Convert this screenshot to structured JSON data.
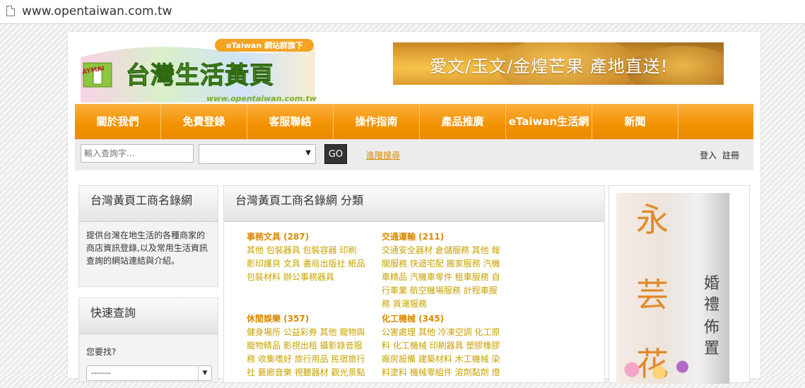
{
  "browser": {
    "url": "www.opentaiwan.com.tw"
  },
  "logo": {
    "badge": "eTaiwan 網站群旗下",
    "title": "台灣生活黃頁",
    "domain": "www.opentaiwan.com.tw",
    "mascot": "AYMAI"
  },
  "banner": {
    "text": "愛文/玉文/金煌芒果 產地直送!"
  },
  "nav": [
    {
      "label": "關於我們"
    },
    {
      "label": "免費登錄"
    },
    {
      "label": "客服聯絡"
    },
    {
      "label": "操作指南"
    },
    {
      "label": "產品推廣"
    },
    {
      "label": "eTaiwan生活網"
    },
    {
      "label": "新聞"
    },
    {
      "label": ""
    }
  ],
  "search": {
    "placeholder": "輸入查詢字...",
    "select_value": "",
    "go_label": "GO",
    "advanced_label": "進階搜尋",
    "login_label": "登入",
    "register_label": "註冊"
  },
  "sidebar": {
    "intro_title": "台灣黃頁工商名錄網",
    "intro_text": "提供台灣在地生活的各種商家的商店資訊登錄,以及常用生活資訊查詢的網站連結與介紹。",
    "quick_title": "快速查詢",
    "quick_label": "您要找?",
    "quick_select": "-------"
  },
  "main": {
    "title": "台灣黃頁工商名錄網 分類",
    "categories": [
      {
        "title": "事務文具 (287)",
        "links": "其他 包裝器具 包裝容器 印刷 影印護貝 文具 書局出版社 紙品包裝材料 辦公事務器具"
      },
      {
        "title": "交通運輸 (211)",
        "links": "交通安全器材 倉儲服務 其他 報關服務 快遞宅配 搬家服務 汽機車精品 汽機車零件 租車服務 自行車業 航空機場服務 計程車服務 貨運服務"
      },
      {
        "title": "休閒娛樂 (357)",
        "links": "健身場所 公益彩券 其他 寵物與寵物精品 影視出租 攝影錄音服務 收集嗜好 旅行用品 民宿旅行社 藝廊音樂 視聽器材 觀光景點"
      },
      {
        "title": "化工機械 (345)",
        "links": "公害處理 其他 冷凍空調 化工原料 化工機械 印刷器具 塑膠橡膠 廠房設備 建築材料 木工機械 染料塗料 機械零組件 溶劑黏劑 燈"
      }
    ]
  },
  "ad": {
    "big_chars": [
      "永",
      "芸",
      "花"
    ],
    "small_chars": [
      "婚",
      "禮",
      "佈",
      "置"
    ]
  }
}
